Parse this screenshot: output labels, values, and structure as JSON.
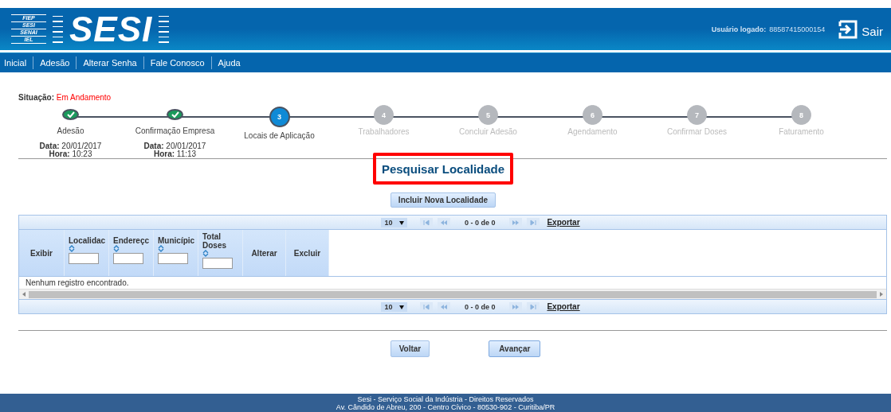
{
  "header": {
    "logo_small": [
      "FIEP",
      "SESI",
      "SENAI",
      "IEL"
    ],
    "logo": "SESI",
    "user_label": "Usuário logado:",
    "user_value": "88587415000154",
    "logout": "Sair"
  },
  "nav": [
    "Inicial",
    "Adesão",
    "Alterar Senha",
    "Fale Conosco",
    "Ajuda"
  ],
  "status": {
    "label": "Situação:",
    "value": "Em Andamento"
  },
  "steps": [
    {
      "label": "Adesão",
      "kind": "done",
      "date_label": "Data:",
      "date": "20/01/2017",
      "time_label": "Hora:",
      "time": "10:23"
    },
    {
      "label": "Confirmação Empresa",
      "kind": "done",
      "date_label": "Data:",
      "date": "20/01/2017",
      "time_label": "Hora:",
      "time": "11:13"
    },
    {
      "number": "3",
      "label": "Locais de Aplicação",
      "kind": "current"
    },
    {
      "number": "4",
      "label": "Trabalhadores",
      "kind": "pending"
    },
    {
      "number": "5",
      "label": "Concluir Adesão",
      "kind": "pending"
    },
    {
      "number": "6",
      "label": "Agendamento",
      "kind": "pending"
    },
    {
      "number": "7",
      "label": "Confirmar Doses",
      "kind": "pending"
    },
    {
      "number": "8",
      "label": "Faturamento",
      "kind": "pending"
    }
  ],
  "title": "Pesquisar Localidade",
  "add_button": "Incluir Nova Localidade",
  "paginator": {
    "page_size": "10",
    "range": "0 - 0 de 0",
    "export": "Exportar"
  },
  "table": {
    "columns": [
      {
        "label": "Exibir",
        "kind": "plain"
      },
      {
        "label": "Localidac",
        "kind": "filter"
      },
      {
        "label": "Endereçc",
        "kind": "filter"
      },
      {
        "label": "Municípic",
        "kind": "filter"
      },
      {
        "label": "Total Doses",
        "kind": "filter"
      },
      {
        "label": "Alterar",
        "kind": "plain"
      },
      {
        "label": "Excluir",
        "kind": "plain"
      }
    ],
    "empty_message": "Nenhum registro encontrado."
  },
  "paginator_bottom": {
    "page_size": "10",
    "range": "0 - 0 de 0",
    "export": "Exportar"
  },
  "buttons": [
    {
      "label": "Voltar",
      "kind": "secondary"
    },
    {
      "label": "Avançar",
      "kind": "primary"
    }
  ],
  "footer": [
    "Sesi - Serviço Social da Indústria - Direitos Reservados",
    "Av. Cândido de Abreu, 200 - Centro Cívico - 80530-902 - Curitiba/PR"
  ]
}
